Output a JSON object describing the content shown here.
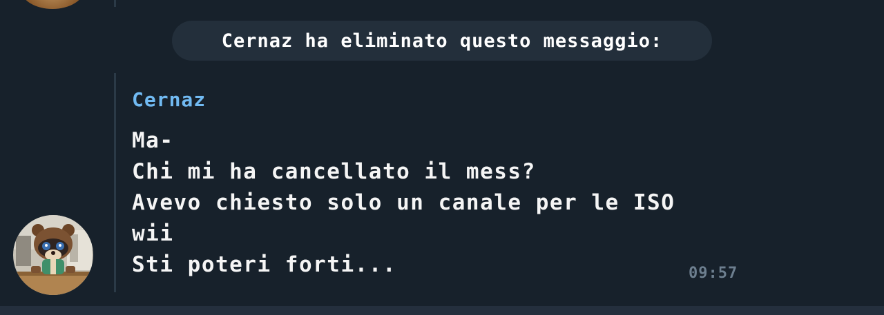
{
  "service_message": {
    "text": "Cernaz ha eliminato questo messaggio:"
  },
  "message": {
    "sender": "Cernaz",
    "lines": [
      "Ma-",
      "Chi mi ha cancellato il mess?",
      "Avevo chiesto solo un canale per le ISO",
      "wii",
      "Sti poteri forti..."
    ],
    "time": "09:57"
  },
  "colors": {
    "background": "#17212b",
    "sender_name": "#71baf2",
    "service_pill": "#232f3b",
    "timestamp": "#6d7f8f"
  }
}
